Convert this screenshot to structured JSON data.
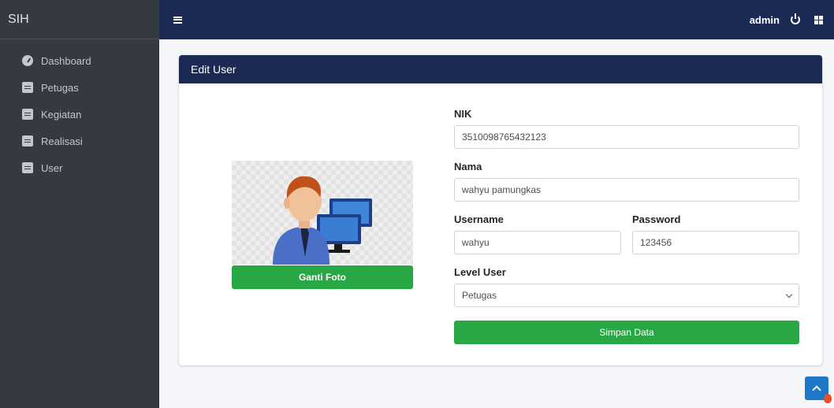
{
  "app": {
    "brand": "SIH"
  },
  "sidebar": {
    "items": [
      {
        "label": "Dashboard",
        "icon": "dashboard-gauge-icon"
      },
      {
        "label": "Petugas",
        "icon": "book-icon"
      },
      {
        "label": "Kegiatan",
        "icon": "book-icon"
      },
      {
        "label": "Realisasi",
        "icon": "book-icon"
      },
      {
        "label": "User",
        "icon": "book-icon"
      }
    ]
  },
  "topbar": {
    "user": "admin",
    "icons": [
      "hamburger-icon",
      "power-icon",
      "grid-icon"
    ]
  },
  "card": {
    "title": "Edit User"
  },
  "photo": {
    "button_label": "Ganti Foto"
  },
  "form": {
    "nik": {
      "label": "NIK",
      "value": "3510098765432123"
    },
    "nama": {
      "label": "Nama",
      "value": "wahyu pamungkas"
    },
    "username": {
      "label": "Username",
      "value": "wahyu"
    },
    "password": {
      "label": "Password",
      "value": "123456"
    },
    "level": {
      "label": "Level User",
      "selected": "Petugas"
    },
    "submit_label": "Simpan Data"
  },
  "colors": {
    "navy": "#1b2a55",
    "sidebar": "#343a40",
    "success": "#28a745",
    "primary": "#1e78c8"
  }
}
